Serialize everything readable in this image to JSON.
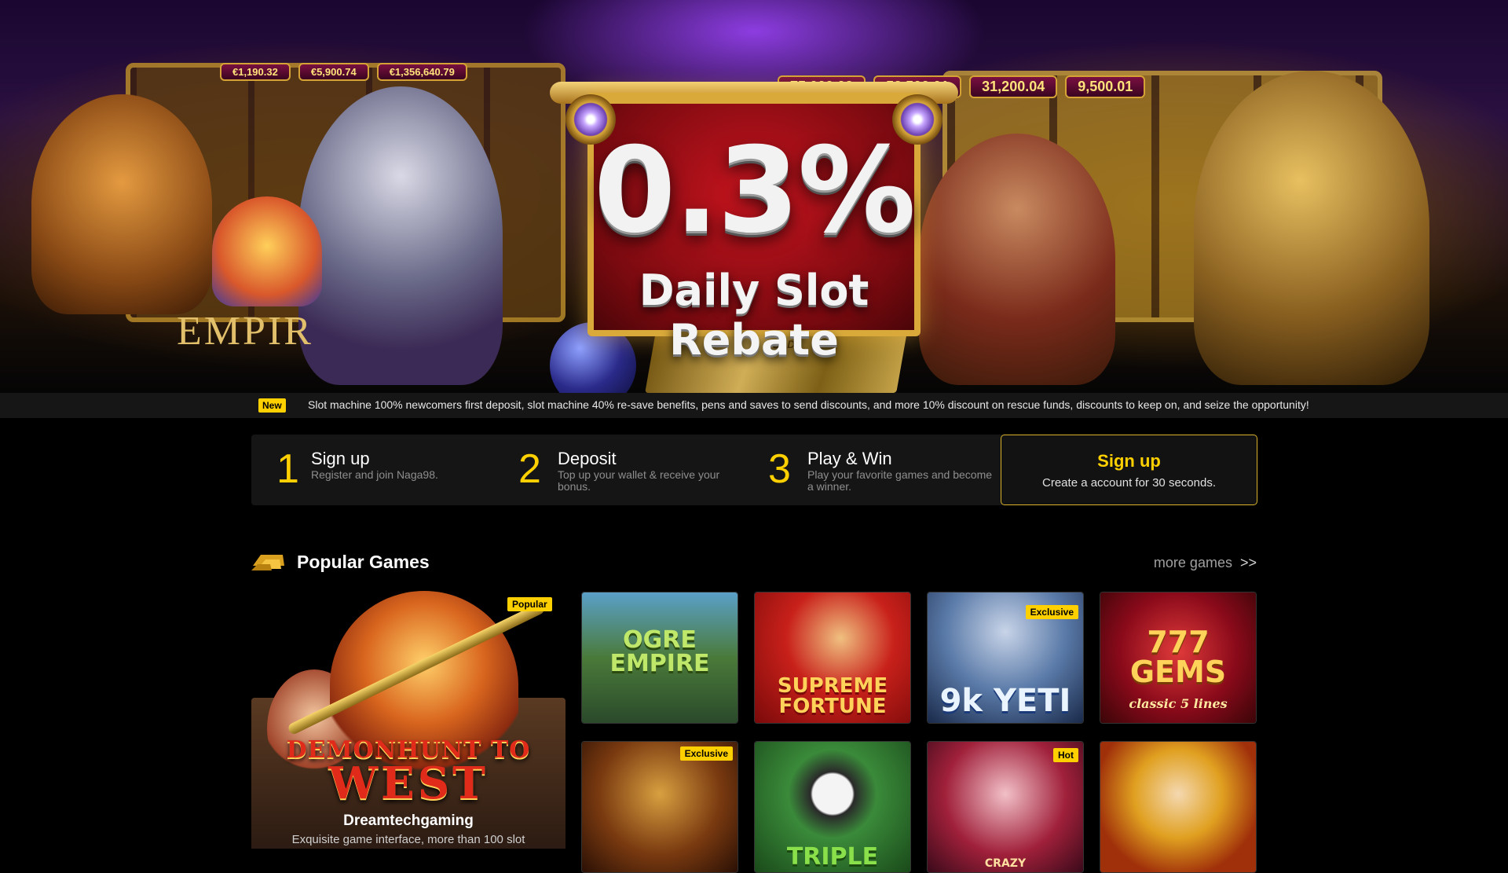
{
  "hero": {
    "rebate_value": "0.3%",
    "rebate_label": "Daily Slot Rebate",
    "jackpots_right": [
      "75,000.02",
      "52,500.01",
      "31,200.04",
      "9,500.01"
    ],
    "jackpots_left": [
      "€1,190.32",
      "€5,900.74",
      "€1,356,640.79"
    ],
    "empire_text": "EMPIR",
    "gold_label": "GOLD"
  },
  "ticker": {
    "badge": "New",
    "text": "Slot machine 100% newcomers first deposit, slot machine 40% re-save benefits, pens and saves to send discounts, and more 10% discount on rescue funds, discounts to keep on, and seize the opportunity!"
  },
  "steps": [
    {
      "num": "1",
      "title": "Sign up",
      "desc": "Register and join Naga98."
    },
    {
      "num": "2",
      "title": "Deposit",
      "desc": "Top up your wallet & receive your bonus."
    },
    {
      "num": "3",
      "title": "Play & Win",
      "desc": "Play your favorite games and become a winner."
    }
  ],
  "signup_box": {
    "title": "Sign up",
    "desc": "Create a account for 30 seconds."
  },
  "popular": {
    "title": "Popular Games",
    "more": "more games",
    "more_arrows": ">>",
    "feature": {
      "tag": "Popular",
      "logo_line1": "DEMONHUNT TO",
      "logo_line2": "WEST",
      "title": "Dreamtechgaming",
      "desc": "Exquisite game interface, more than 100 slot"
    },
    "tiles": [
      {
        "title": "OGRE EMPIRE",
        "tag": ""
      },
      {
        "title": "SUPREME FORTUNE",
        "tag": ""
      },
      {
        "title": "9k YETI",
        "tag": "Exclusive"
      },
      {
        "title": "777 GEMS",
        "subtitle": "classic 5 lines",
        "tag": ""
      },
      {
        "title": "",
        "tag": "Exclusive"
      },
      {
        "title": "TRIPLE",
        "tag": ""
      },
      {
        "title": "CRAZY",
        "tag": "Hot"
      },
      {
        "title": "",
        "tag": ""
      }
    ]
  },
  "colors": {
    "accent": "#ffd000",
    "background": "#000000",
    "panel": "#151515"
  }
}
